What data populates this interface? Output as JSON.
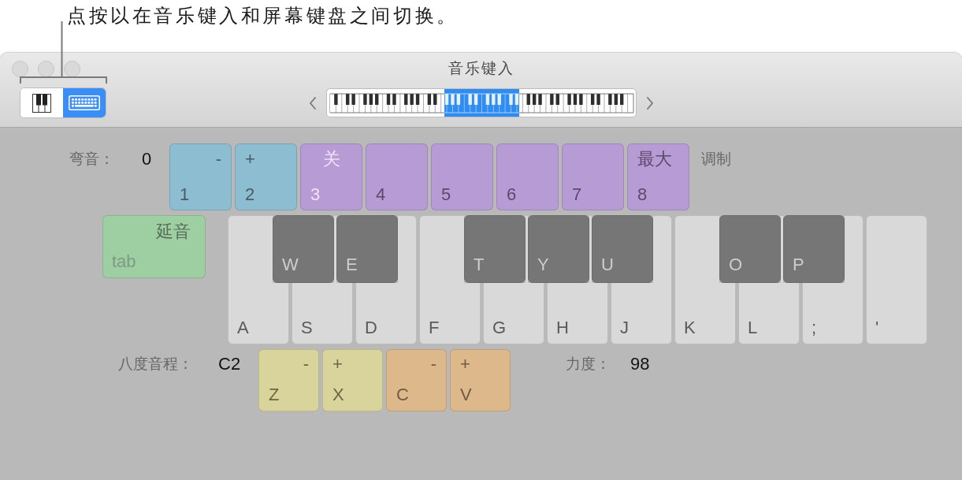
{
  "callout": {
    "text": "点按以在音乐键入和屏幕键盘之间切换。"
  },
  "window": {
    "title": "音乐键入"
  },
  "toolbar": {
    "view_modes": [
      {
        "kind": "piano",
        "selected": false
      },
      {
        "kind": "keyboard",
        "selected": true
      }
    ]
  },
  "pitch_bend": {
    "label": "弯音：",
    "value": "0",
    "keys": [
      {
        "kind": "down",
        "action": "-",
        "key": "1"
      },
      {
        "kind": "up",
        "action": "+",
        "key": "2"
      }
    ]
  },
  "modulation": {
    "label": "调制",
    "keys": [
      {
        "kind": "off",
        "action": "关",
        "key": "3",
        "selected": true
      },
      {
        "key": "4",
        "selected": false
      },
      {
        "key": "5",
        "selected": false
      },
      {
        "key": "6",
        "selected": false
      },
      {
        "key": "7",
        "selected": false
      },
      {
        "kind": "max",
        "action": "最大",
        "key": "8",
        "selected": false
      }
    ]
  },
  "sustain": {
    "action": "延音",
    "key": "tab"
  },
  "note_keys": [
    {
      "key": "A",
      "sharp": "W"
    },
    {
      "key": "S",
      "sharp": "E"
    },
    {
      "key": "D"
    },
    {
      "key": "F",
      "sharp": "T"
    },
    {
      "key": "G",
      "sharp": "Y"
    },
    {
      "key": "H",
      "sharp": "U"
    },
    {
      "key": "J"
    },
    {
      "key": "K",
      "sharp": "O"
    },
    {
      "key": "L",
      "sharp": "P"
    },
    {
      "key": ";"
    },
    {
      "key": "'"
    }
  ],
  "octave": {
    "label": "八度音程：",
    "value": "C2",
    "keys": [
      {
        "kind": "down",
        "action": "-",
        "key": "Z"
      },
      {
        "kind": "up",
        "action": "+",
        "key": "X"
      }
    ]
  },
  "velocity": {
    "label": "力度：",
    "value": "98",
    "keys": [
      {
        "kind": "down",
        "action": "-",
        "key": "C"
      },
      {
        "kind": "up",
        "action": "+",
        "key": "V"
      }
    ]
  }
}
